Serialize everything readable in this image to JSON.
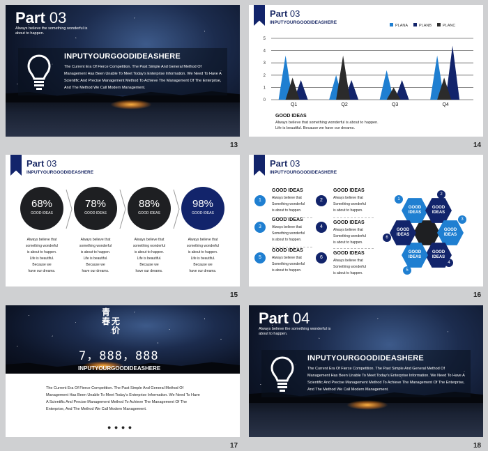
{
  "slides": {
    "s13": {
      "number": "13",
      "part_word": "Part",
      "part_num": "03",
      "part_sub": "Always believe the something wonderful is about to happen.",
      "title": "INPUTYOURGOODIDEASHERE",
      "body": "The Current Era Of Fierce Competition. The Past Simple And General Method Of Management Has Been Unable To Meet Today’s Enterprise Information. We Need To Have A Scientific And Precise Management Method To Achieve The Management Of The Enterprise, And The Method We Call Modern Management."
    },
    "s14": {
      "number": "14",
      "part_word": "Part",
      "part_num": "03",
      "header_sub": "INPUTYOURGOODIDEASHERE",
      "good_ideas": "GOOD IDEAS",
      "caption_line1": "Always believe that something wonderful is about to happen.",
      "caption_line2": "Life is beautiful. Because we have our dreams."
    },
    "s15": {
      "number": "15",
      "part_word": "Part",
      "part_num": "03",
      "header_sub": "INPUTYOURGOODIDEASHERE",
      "circles": [
        {
          "pct": "68%",
          "label": "GOOD IDEAS",
          "color": "#1e1f22"
        },
        {
          "pct": "78%",
          "label": "GOOD IDEAS",
          "color": "#1e1f22"
        },
        {
          "pct": "88%",
          "label": "GOOD IDEAS",
          "color": "#1e1f22"
        },
        {
          "pct": "98%",
          "label": "GOOD IDEAS",
          "color": "#12246b"
        }
      ],
      "caption": [
        "Always believe that",
        "something wonderful",
        "is about to happen.",
        "Life is beautiful.",
        "Because we",
        "have our dreams."
      ]
    },
    "s16": {
      "number": "16",
      "part_word": "Part",
      "part_num": "03",
      "header_sub": "INPUTYOURGOODIDEASHERE",
      "items": [
        {
          "n": "1",
          "title": "GOOD IDEAS",
          "lines": [
            "Always believe that",
            "Something wonderful",
            "is about to happen."
          ],
          "color": "#1f7fd1"
        },
        {
          "n": "2",
          "title": "GOOD IDEAS",
          "lines": [
            "Always believe that",
            "Something wonderful",
            "is about to happen."
          ],
          "color": "#12246b"
        },
        {
          "n": "3",
          "title": "GOOD IDEAS",
          "lines": [
            "Always believe that",
            "Something wonderful",
            "is about to happen."
          ],
          "color": "#1f7fd1"
        },
        {
          "n": "4",
          "title": "GOOD IDEAS",
          "lines": [
            "Always believe that",
            "Something wonderful",
            "is about to happen."
          ],
          "color": "#12246b"
        },
        {
          "n": "5",
          "title": "GOOD IDEAS",
          "lines": [
            "Always believe that",
            "Something wonderful",
            "is about to happen."
          ],
          "color": "#1f7fd1"
        },
        {
          "n": "6",
          "title": "GOOD IDEAS",
          "lines": [
            "Always believe that",
            "Something wonderful",
            "is about to happen."
          ],
          "color": "#12246b"
        }
      ],
      "hexes": [
        {
          "n": "1",
          "text": "GOOD IDEAS",
          "color": "#1f7fd1"
        },
        {
          "n": "2",
          "text": "GOOD IDEAS",
          "color": "#12246b"
        },
        {
          "n": "3",
          "text": "GOOD IDEAS",
          "color": "#1f7fd1"
        },
        {
          "n": "4",
          "text": "GOOD IDEAS",
          "color": "#12246b"
        },
        {
          "n": "5",
          "text": "GOOD IDEAS",
          "color": "#1f7fd1"
        },
        {
          "n": "6",
          "text": "GOOD IDEAS",
          "color": "#12246b"
        }
      ]
    },
    "s17": {
      "number": "17",
      "cn1": "青",
      "cn2": "春",
      "cn3": "无",
      "cn4": "价",
      "big_number": "7，888，888",
      "title": "INPUTYOURGOODIDEASHERE",
      "body": "The Current Era Of Fierce Competition. The Past Simple And General Method Of Management Has Been Unable To Meet Today’s Enterprise Information. We Need To Have A Scientific And Precise Management Method To Achieve The Management Of The Enterprise, And The Method We Call Modern Management.",
      "dots": "● ● ● ●"
    },
    "s18": {
      "number": "18",
      "part_word": "Part",
      "part_num": "04",
      "part_sub": "Always believe the something wonderful is about to happen.",
      "title": "INPUTYOURGOODIDEASHERE",
      "body": "The Current Era Of Fierce Competition. The Past Simple And General Method Of Management Has Been Unable To Meet Today’s Enterprise Information. We Need To Have A Scientific And Precise Management Method To Achieve The Management Of The Enterprise, And The Method We Call Modern Management."
    }
  },
  "chart_data": {
    "type": "area",
    "categories": [
      "Q1",
      "Q2",
      "Q3",
      "Q4"
    ],
    "yticks": [
      "0",
      "1",
      "2",
      "3",
      "4",
      "5"
    ],
    "ylim": [
      0,
      5
    ],
    "series": [
      {
        "name": "PLANA",
        "color": "#1f7fd1",
        "values": [
          3.6,
          2.0,
          2.4,
          3.6
        ]
      },
      {
        "name": "PLANB",
        "color": "#12246b",
        "values": [
          1.6,
          1.6,
          1.6,
          4.4
        ]
      },
      {
        "name": "PLANC",
        "color": "#2b2b2b",
        "values": [
          1.8,
          3.6,
          1.0,
          1.8
        ]
      }
    ],
    "legend": "top-right"
  }
}
